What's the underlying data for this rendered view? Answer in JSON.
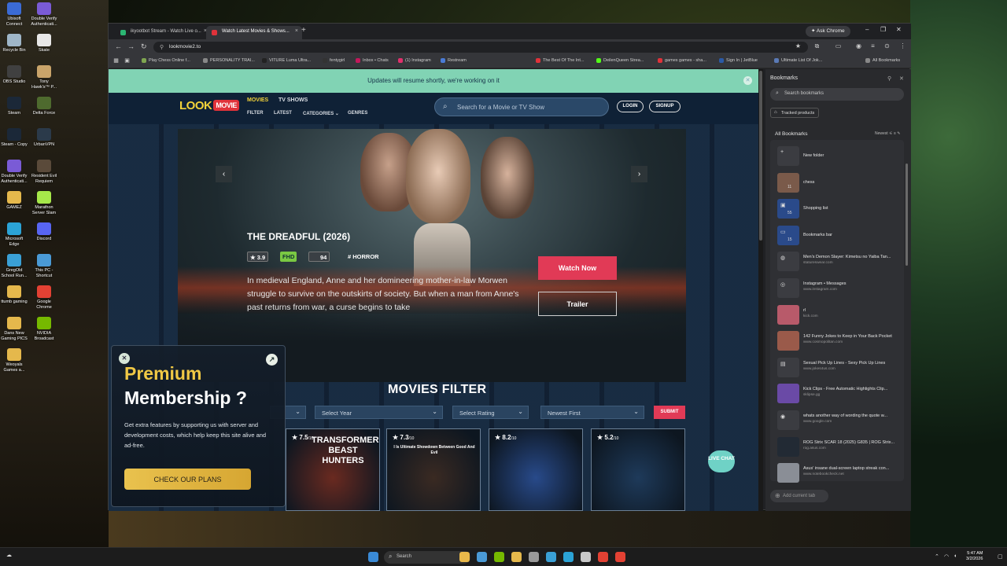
{
  "desktop": {
    "icons": [
      {
        "label": "Ubisoft Connect",
        "color": "#3b6bd6"
      },
      {
        "label": "Double Verify Authenticati...",
        "color": "#7a5bd6"
      },
      {
        "label": "Recycle Bin",
        "color": "#9fb6c8"
      },
      {
        "label": "Skate",
        "color": "#e8e8e8"
      },
      {
        "label": "OBS Studio",
        "color": "#404040"
      },
      {
        "label": "Tony Hawk's™ P...",
        "color": "#c9a46a"
      },
      {
        "label": "Steam",
        "color": "#1b2838"
      },
      {
        "label": "Delta Force",
        "color": "#4e6a2e"
      },
      {
        "label": "Steam - Copy",
        "color": "#1b2838"
      },
      {
        "label": "UrbanVPN",
        "color": "#2b3a4a"
      },
      {
        "label": "Double Verify Authenticati...",
        "color": "#7a5bd6"
      },
      {
        "label": "Resident Evil Requiem",
        "color": "#5a4a3a"
      },
      {
        "label": "GAMEZ",
        "color": "#e5b84c"
      },
      {
        "label": "Marathon Server Slam",
        "color": "#a6e84a"
      },
      {
        "label": "Microsoft Edge",
        "color": "#2ba3d6"
      },
      {
        "label": "Discord",
        "color": "#5865f2"
      },
      {
        "label": "GregOld School Run...",
        "color": "#3aa0d6"
      },
      {
        "label": "This PC - Shortcut",
        "color": "#4a9ad6"
      },
      {
        "label": "ttumb gaming",
        "color": "#e5b84c"
      },
      {
        "label": "Google Chrome",
        "color": "#e34133"
      },
      {
        "label": "Dans New Gaming PICS",
        "color": "#e5b84c"
      },
      {
        "label": "NVIDIA Broadcast",
        "color": "#76b900"
      },
      {
        "label": "Weoyals Games a...",
        "color": "#e5b84c"
      }
    ]
  },
  "browser": {
    "tabs": [
      {
        "label": "ikyootbot Stream - Watch Live o...",
        "color": "#2bb673",
        "active": false
      },
      {
        "label": "Watch Latest Movies & Shows...",
        "color": "#e0323a",
        "active": true
      }
    ],
    "ask_chrome": "✦ Ask Chrome",
    "url": "lookmovie2.to",
    "bookmarks_bar": [
      {
        "label": "Play Chess Online f...",
        "color": "#7fa650"
      },
      {
        "label": "PERSONALITY TRAI...",
        "color": "#888888"
      },
      {
        "label": "VITURE Luma Ultra...",
        "color": "#222222"
      },
      {
        "label": "fentygirl",
        "color": "#333333"
      },
      {
        "label": "Inbox • Chats",
        "color": "#c2185b"
      },
      {
        "label": "(1) Instagram",
        "color": "#e1306c"
      },
      {
        "label": "Restream",
        "color": "#4a7bd6"
      },
      {
        "label": "The Best Of The Int...",
        "color": "#e0323a"
      },
      {
        "label": "DeilenQueen Strea...",
        "color": "#53fc18"
      },
      {
        "label": "games games - sha...",
        "color": "#e0323a"
      },
      {
        "label": "Sign In | JetBlue",
        "color": "#2b5aa6"
      },
      {
        "label": "Ultimate List Of Jok...",
        "color": "#5a7ab6"
      },
      {
        "label": "All Bookmarks",
        "color": "#888888"
      }
    ]
  },
  "site": {
    "notice": "Updates will resume shortly, we're working on it",
    "logo_text": "LOOK",
    "logo_badge": "MOVIE",
    "nav_top": [
      "MOVIES",
      "TV SHOWS"
    ],
    "nav_bottom": [
      "FILTER",
      "LATEST",
      "CATEGORIES ⌄",
      "GENRES"
    ],
    "search_placeholder": "Search for a Movie or TV Show",
    "login": "LOGIN",
    "signup": "SIGNUP",
    "hero": {
      "title": "THE DREADFUL (2026)",
      "rating": "★ 3.9",
      "quality": "FHD",
      "score": "94",
      "genre": "# HORROR",
      "description": "In medieval England, Anne and her domineering mother-in-law Morwen struggle to survive on the outskirts of society. But when a man from Anne's past returns from war, a curse begins to take",
      "watch_now": "Watch Now",
      "trailer": "Trailer",
      "prev": "‹",
      "next": "›"
    },
    "filter": {
      "title": "MOVIES FILTER",
      "select_year": "Select Year",
      "select_rating": "Select Rating",
      "sort": "Newest First",
      "submit": "SUBMIT"
    },
    "cards": [
      {
        "rating": "★ 7.5",
        "of": "/10",
        "caption": "TRANSFORMERS BEAST HUNTERS",
        "bg": "#6a2a20"
      },
      {
        "rating": "★ 7.3",
        "of": "/10",
        "caption": "I Is Ultimate Showdown Between Good And Evil",
        "bg": "#3a2a22"
      },
      {
        "rating": "★ 8.2",
        "of": "/10",
        "caption": "",
        "bg": "#284a8a"
      },
      {
        "rating": "★ 5.2",
        "of": "/10",
        "caption": "",
        "bg": "#1e3a5a"
      }
    ],
    "live_chat": "LIVE CHAT"
  },
  "premium": {
    "title1": "Premium",
    "title2": "Membership ?",
    "description": "Get extra features by supporting us with server and development costs, which help keep this site alive and ad-free.",
    "button": "CHECK OUR PLANS"
  },
  "bookmarks_panel": {
    "title": "Bookmarks",
    "search_placeholder": "Search bookmarks",
    "tracked": "Tracked products",
    "all": "All Bookmarks",
    "sort": "Newest",
    "add_tab": "Add current tab",
    "items": [
      {
        "title": "New folder",
        "url": "",
        "count": "",
        "glyph": "+",
        "color": "#3b3c41"
      },
      {
        "title": "chess",
        "url": "",
        "count": "11",
        "glyph": "",
        "color": "#7a5a4a"
      },
      {
        "title": "Shopping list",
        "url": "",
        "count": "55",
        "glyph": "▣",
        "color": "#2a4a8a"
      },
      {
        "title": "Bookmarks bar",
        "url": "",
        "count": "15",
        "glyph": "▭",
        "color": "#2a4a8a"
      },
      {
        "title": "Men's Demon Slayer: Kimetsu no Yaiba Tan...",
        "url": "statureswear.com",
        "count": "",
        "glyph": "◍",
        "color": "#3b3c41"
      },
      {
        "title": "Instagram • Messages",
        "url": "www.instagram.com",
        "count": "",
        "glyph": "◎",
        "color": "#3b3c41"
      },
      {
        "title": "rl",
        "url": "kick.com",
        "count": "",
        "glyph": "",
        "color": "#b85a6a"
      },
      {
        "title": "142 Funny Jokes to Keep in Your Back Pocket",
        "url": "www.cosmopolitan.com",
        "count": "",
        "glyph": "",
        "color": "#9a5a4a"
      },
      {
        "title": "Sexual Pick Up Lines - Sexy Pick Up Lines",
        "url": "www.jokes4us.com",
        "count": "",
        "glyph": "▤",
        "color": "#3b3c41"
      },
      {
        "title": "Kick Clips - Free Automatic Highlights Clip...",
        "url": "sklipse.gg",
        "count": "",
        "glyph": "",
        "color": "#6a4aa6"
      },
      {
        "title": "whats another way of wording the quote w...",
        "url": "www.google.com",
        "count": "",
        "glyph": "◉",
        "color": "#3b3c41"
      },
      {
        "title": "ROG Strix SCAR 18 (2025) G835 | ROG Strix...",
        "url": "rog.asus.com",
        "count": "",
        "glyph": "",
        "color": "#222a34"
      },
      {
        "title": "Asus' insane dual-screen laptop streak con...",
        "url": "www.notebookcheck.net",
        "count": "",
        "glyph": "",
        "color": "#8a8e96"
      }
    ]
  },
  "taskbar": {
    "search": "Search",
    "time": "5:47 AM",
    "date": "3/2/2026",
    "apps": [
      "#e9b84a",
      "#4a9ad6",
      "#76b900",
      "#e5b84c",
      "#9a9a9a",
      "#3aa0d6",
      "#2ba3d6",
      "#c8c8c8",
      "#e34133",
      "#e34133"
    ]
  }
}
